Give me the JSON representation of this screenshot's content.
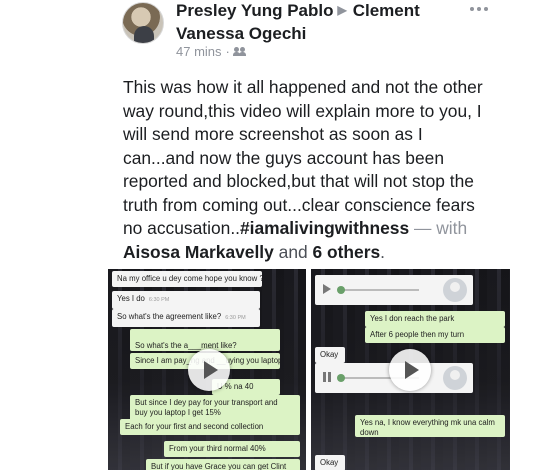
{
  "post": {
    "author": "Presley Yung Pablo",
    "recipient_line1": "Clement",
    "recipient_line2": "Vanessa Ogechi",
    "time": "47 mins",
    "body_lines": [
      "This was how it all happened and not the other",
      "way round,this video will explain more to  you, I",
      "will send more screenshot as soon as I",
      "can...and now the guys account has been",
      "reported and blocked,but that will not stop the",
      "truth from coming out...clear conscience fears"
    ],
    "last_line_prefix": "no accusation..",
    "hashtag": "#iamalivingwithness",
    "with_text": "— with",
    "tagged_person": "Aisosa Markavelly",
    "and_text": "and",
    "others": "6 others",
    "period": "."
  },
  "icons": {
    "arrow": "triangle-right-icon",
    "audience": "friends-icon",
    "more": "more-dots-icon",
    "play": "play-icon"
  },
  "media_left": {
    "messages": [
      {
        "text": "Na my office u dey come hope you know ?",
        "time": "",
        "dir": "in"
      },
      {
        "text": "Yes I do",
        "time": "6:30 PM",
        "dir": "in"
      },
      {
        "text": "So what's the agreement like?",
        "time": "6:30 PM",
        "dir": "in"
      },
      {
        "text": "So what's the a___ment like?",
        "time": "",
        "dir": "out"
      },
      {
        "text": "Since I am pay_ng and __uying you laptop",
        "time": "",
        "dir": "out"
      },
      {
        "text": "U % na 40",
        "time": "",
        "dir": "out"
      },
      {
        "text": "But since I dey pay for your transport and",
        "time": "",
        "dir": "out"
      },
      {
        "text": "buy you laptop I get 15%",
        "time": "",
        "dir": "out"
      },
      {
        "text": "Each for your first and second collection",
        "time": "",
        "dir": "out"
      },
      {
        "text": "From your third normal 40%",
        "time": "",
        "dir": "out"
      },
      {
        "text": "But if you have Grace you can get Clint",
        "time": "",
        "dir": "out"
      }
    ]
  },
  "media_right": {
    "messages": [
      {
        "text": "Yes I don reach the park",
        "time": "",
        "dir": "out"
      },
      {
        "text": "After 6 people then my turn",
        "time": "",
        "dir": "out"
      },
      {
        "text": "Okay",
        "time": "",
        "dir": "in"
      },
      {
        "text": "Yes na, I know everything mk una calm",
        "time": "",
        "dir": "out"
      },
      {
        "text": "down",
        "time": "",
        "dir": "out"
      },
      {
        "text": "Okay",
        "time": "",
        "dir": "in"
      }
    ]
  }
}
